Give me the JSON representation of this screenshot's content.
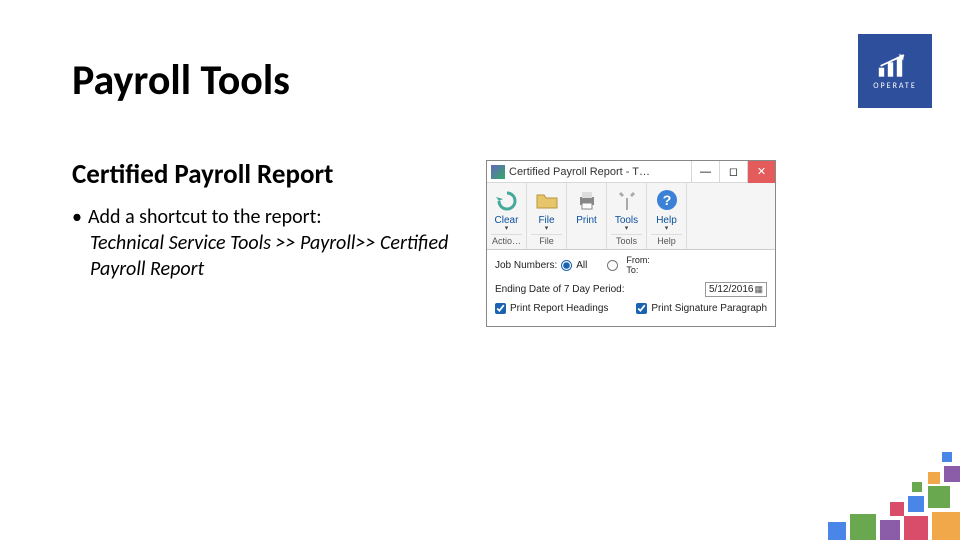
{
  "slide": {
    "title": "Payroll Tools",
    "section_title": "Certified Payroll Report",
    "bullet_lead": "Add a shortcut to the report:",
    "bullet_detail": "Technical Service Tools >> Payroll>> Certified Payroll Report"
  },
  "logo": {
    "text": "OPERATE"
  },
  "window": {
    "title": "Certified Payroll Report  -  T…",
    "ribbon": {
      "clear": "Clear",
      "file": "File",
      "print": "Print",
      "tools": "Tools",
      "help": "Help",
      "cat_actions": "Actio…",
      "cat_file": "File",
      "cat_tools": "Tools",
      "cat_help": "Help"
    },
    "form": {
      "job_numbers_label": "Job Numbers:",
      "opt_all": "All",
      "opt_from": "From:",
      "opt_to": "To:",
      "ending_date_label": "Ending Date of 7 Day Period:",
      "ending_date_value": "5/12/2016",
      "cb_print_headings": "Print Report Headings",
      "cb_print_signature": "Print Signature Paragraph"
    }
  }
}
